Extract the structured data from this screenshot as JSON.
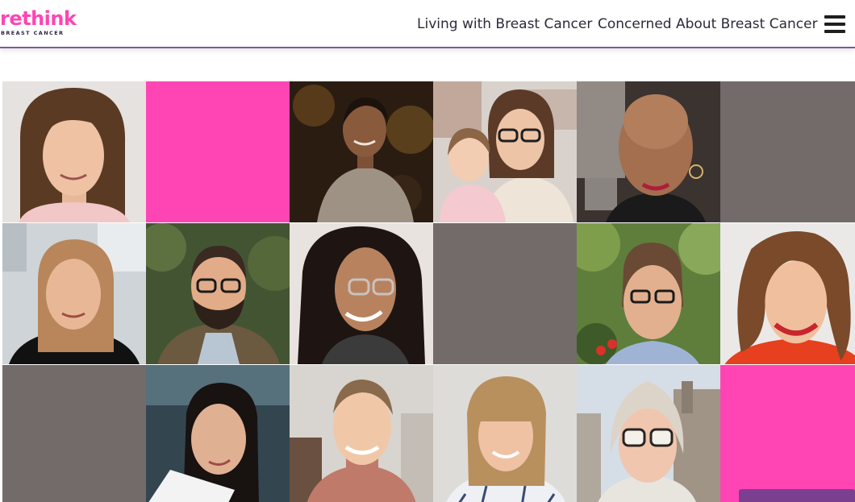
{
  "brand": {
    "logo_word": "rethink",
    "logo_sub": "BREAST CANCER",
    "accent_pink": "#ff45b4",
    "grey_tile": "#736b6a",
    "purple_rule": "#7b5a9e"
  },
  "nav": {
    "items": [
      {
        "label": "Living with Breast Cancer"
      },
      {
        "label": "Concerned About Breast Cancer"
      }
    ],
    "menu_icon": "hamburger-menu-icon"
  },
  "photo_grid": {
    "rows": 3,
    "columns": 6,
    "tiles": [
      {
        "kind": "photo",
        "subject": "woman-brown-bob"
      },
      {
        "kind": "block",
        "color": "#ff45b4"
      },
      {
        "kind": "photo",
        "subject": "woman-grey-sweater"
      },
      {
        "kind": "photo",
        "subject": "woman-with-child"
      },
      {
        "kind": "photo",
        "subject": "woman-bald-earrings"
      },
      {
        "kind": "block",
        "color": "#736b6a"
      },
      {
        "kind": "photo",
        "subject": "woman-blonde-black-top"
      },
      {
        "kind": "photo",
        "subject": "man-beard-glasses"
      },
      {
        "kind": "photo",
        "subject": "woman-glasses-long-hair"
      },
      {
        "kind": "block",
        "color": "#736b6a"
      },
      {
        "kind": "photo",
        "subject": "woman-glasses-garden"
      },
      {
        "kind": "photo",
        "subject": "woman-curly-red-top"
      },
      {
        "kind": "block",
        "color": "#736b6a"
      },
      {
        "kind": "photo",
        "subject": "woman-dark-hair-card"
      },
      {
        "kind": "photo",
        "subject": "woman-pink-turtleneck"
      },
      {
        "kind": "photo",
        "subject": "woman-bangs-stripes"
      },
      {
        "kind": "photo",
        "subject": "woman-glasses-city"
      },
      {
        "kind": "block",
        "color": "#ff45b4"
      }
    ]
  }
}
